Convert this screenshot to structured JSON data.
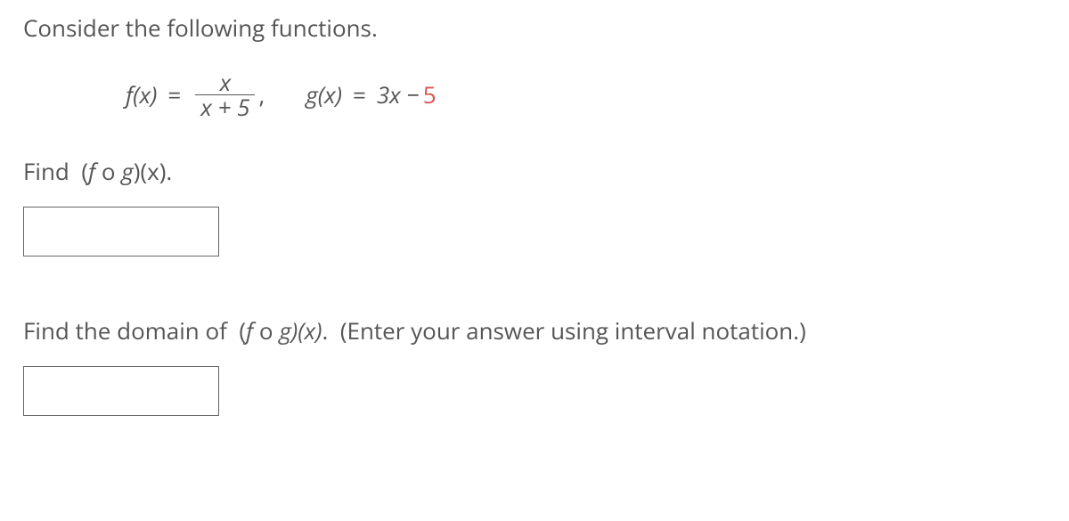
{
  "intro": "Consider the following functions.",
  "f": {
    "lhs": "f(x)",
    "eq": "=",
    "num": "x",
    "den": "x + 5"
  },
  "g": {
    "lhs": "g(x)",
    "eq": "=",
    "rhs_pre": "3x − ",
    "rhs_num": "5"
  },
  "q1": {
    "prefix": "Find  (",
    "f": "f",
    "op": " o ",
    "g": "g",
    "suffix": ")(x)."
  },
  "q2": {
    "prefix": "Find the domain of  (",
    "f": "f",
    "op": " o ",
    "g": "g",
    "mid": ")(x)",
    "suffix": ".  (Enter your answer using interval notation.)"
  },
  "chart_data": {
    "type": "table",
    "title": "Function composition problem",
    "functions": {
      "f(x)": "x / (x + 5)",
      "g(x)": "3x - 5"
    },
    "tasks": [
      "Find (f ∘ g)(x).",
      "Find the domain of (f ∘ g)(x). (Enter your answer using interval notation.)"
    ]
  }
}
